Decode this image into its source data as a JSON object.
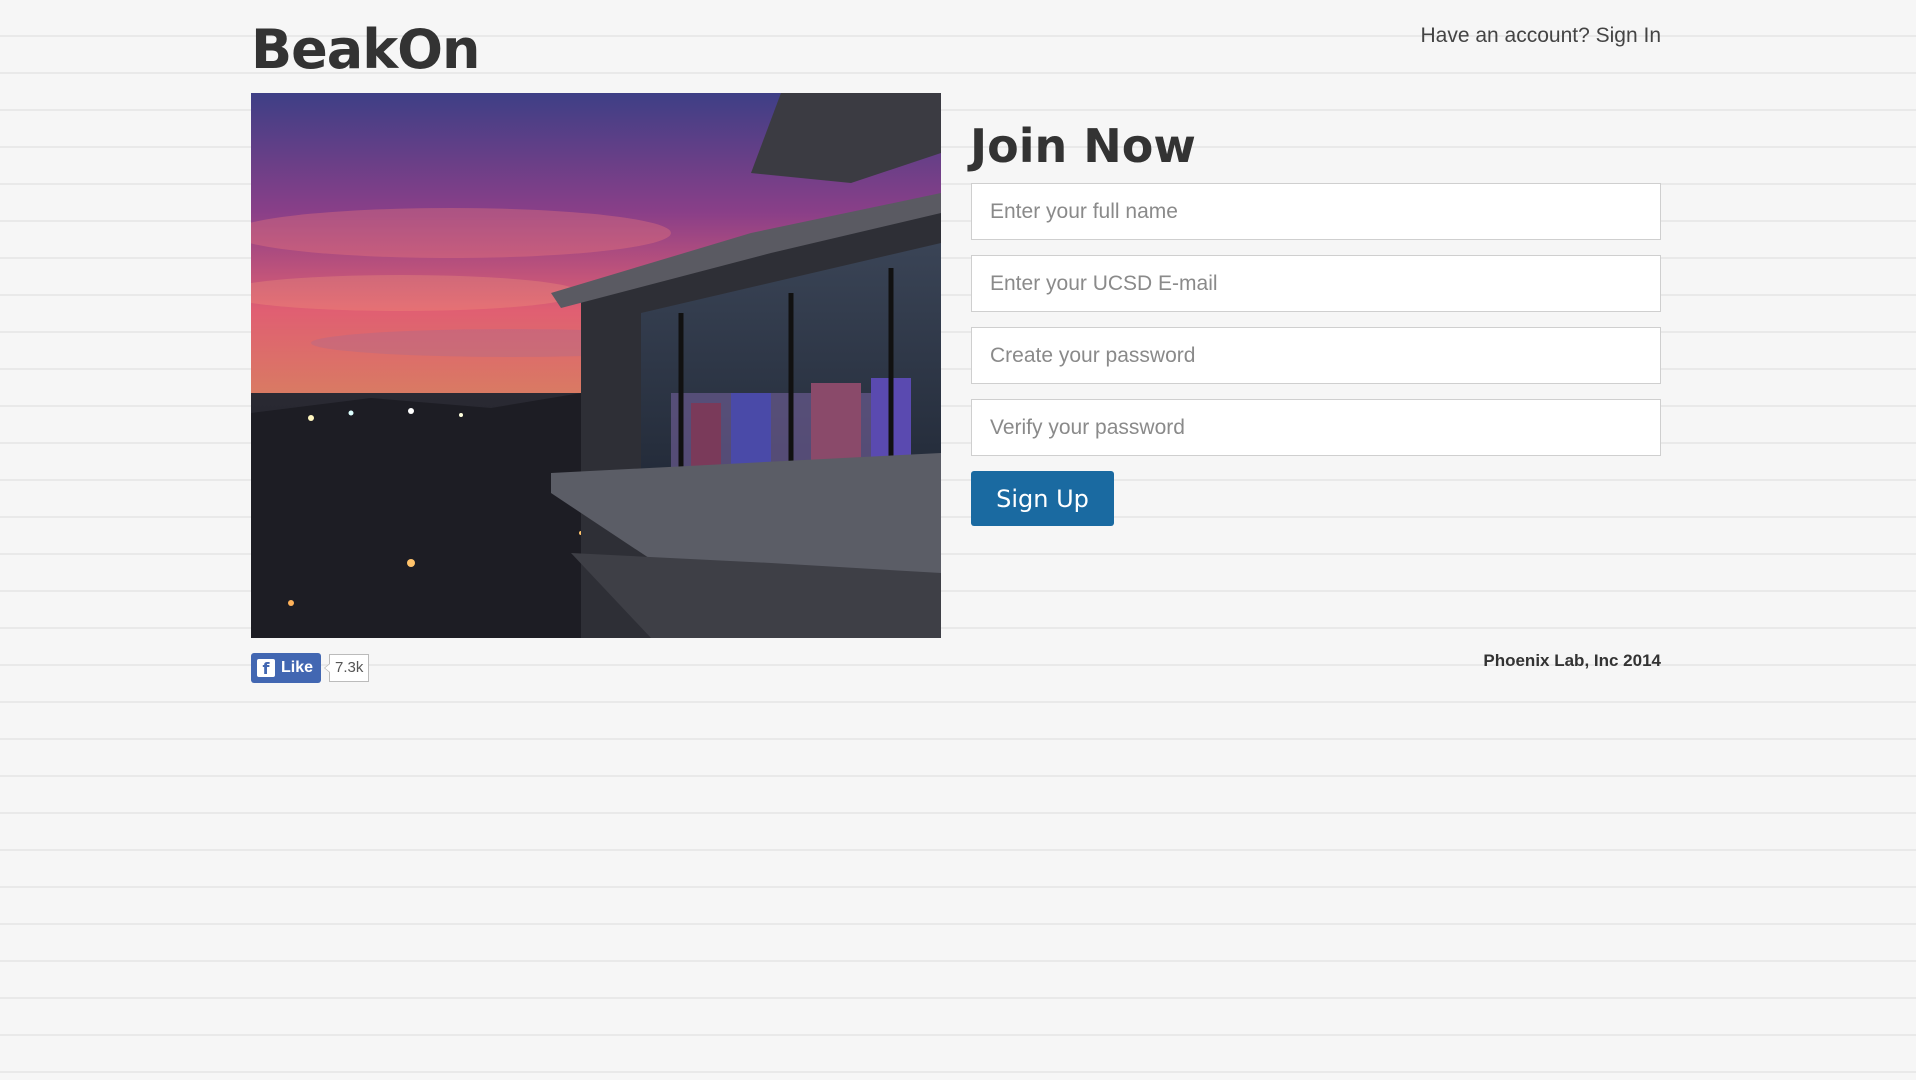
{
  "header": {
    "brand": "BeakOn",
    "signin_link": "Have an account? Sign In"
  },
  "signup": {
    "title": "Join Now",
    "fields": {
      "full_name_placeholder": "Enter your full name",
      "email_placeholder": "Enter your UCSD E-mail",
      "password_placeholder": "Create your password",
      "verify_placeholder": "Verify your password"
    },
    "button_label": "Sign Up"
  },
  "hero_image": {
    "icon": "campus-library-sunset-photo"
  },
  "facebook": {
    "like_label": "Like",
    "count": "7.3k",
    "icon": "facebook-icon"
  },
  "footer": {
    "copyright": "Phoenix Lab, Inc 2014"
  },
  "colors": {
    "primary_button": "#1a6aa1",
    "facebook_blue": "#4267b2",
    "text": "#333333"
  }
}
